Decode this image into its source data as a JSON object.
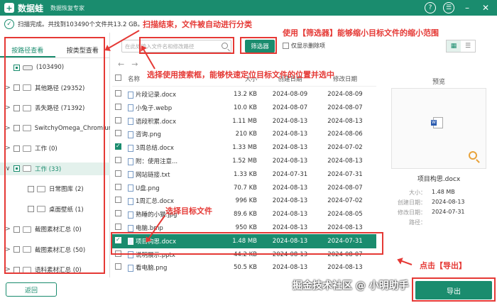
{
  "titlebar": {
    "logo_glyph": "+",
    "app_name": "数据蛙",
    "app_subtitle": "数据恢复专家",
    "controls": [
      "?",
      "☰",
      "–",
      "✕"
    ]
  },
  "status": {
    "text": "扫描完成。共找到103490个文件共13.2 GB。"
  },
  "left": {
    "tabs": [
      "按路径查看",
      "按类型查看"
    ],
    "tree": [
      {
        "label": "(103490)",
        "indent": 0,
        "arrow": "",
        "kind": "drive",
        "check": "part",
        "selected": false
      },
      {
        "label": "其他路径 (29352)",
        "indent": 0,
        "arrow": ">",
        "kind": "folder",
        "check": "none",
        "selected": false
      },
      {
        "label": "丢失路径 (71392)",
        "indent": 0,
        "arrow": ">",
        "kind": "folder",
        "check": "none",
        "selected": false
      },
      {
        "label": "SwitchyOmega_Chromiur",
        "indent": 0,
        "arrow": ">",
        "kind": "folder",
        "check": "none",
        "selected": false
      },
      {
        "label": "工作 (0)",
        "indent": 0,
        "arrow": ">",
        "kind": "folder",
        "check": "none",
        "selected": false
      },
      {
        "label": "工作 (33)",
        "indent": 0,
        "arrow": "∨",
        "kind": "folder",
        "check": "part",
        "selected": true
      },
      {
        "label": "日常图库 (2)",
        "indent": 1,
        "arrow": "",
        "kind": "folder",
        "check": "none",
        "selected": false
      },
      {
        "label": "桌面壁纸 (1)",
        "indent": 1,
        "arrow": "",
        "kind": "folder",
        "check": "none",
        "selected": false
      },
      {
        "label": "截图素材汇总 (0)",
        "indent": 0,
        "arrow": ">",
        "kind": "folder",
        "check": "none",
        "selected": false
      },
      {
        "label": "截图素材汇总 (50)",
        "indent": 0,
        "arrow": ">",
        "kind": "folder",
        "check": "none",
        "selected": false
      },
      {
        "label": "语料素材汇总 (0)",
        "indent": 0,
        "arrow": ">",
        "kind": "folder",
        "check": "none",
        "selected": false
      }
    ],
    "back_label": "返回"
  },
  "toolbar": {
    "search_placeholder": "在此处输入文件名和修改路径",
    "filter_label": "筛选器",
    "only_deleted_label": "仅显示删除项",
    "view_modes": [
      "▦",
      "☰"
    ]
  },
  "nav": {
    "back": "←",
    "forward": "→"
  },
  "table": {
    "headers": {
      "name": "名称",
      "size": "大小",
      "created": "创建日期",
      "modified": "修改日期"
    },
    "rows": [
      {
        "name": "片段记录.docx",
        "size": "13.2 KB",
        "created": "2024-08-09",
        "modified": "2024-08-09",
        "checked": false,
        "selected": false
      },
      {
        "name": "小兔子.webp",
        "size": "10.0 KB",
        "created": "2024-08-07",
        "modified": "2024-08-07",
        "checked": false,
        "selected": false
      },
      {
        "name": "语段积累.docx",
        "size": "1.11 MB",
        "created": "2024-08-13",
        "modified": "2024-08-13",
        "checked": false,
        "selected": false
      },
      {
        "name": "咨询.png",
        "size": "210 KB",
        "created": "2024-08-13",
        "modified": "2024-08-06",
        "checked": false,
        "selected": false
      },
      {
        "name": "3周总结.docx",
        "size": "1.33 MB",
        "created": "2024-08-13",
        "modified": "2024-07-02",
        "checked": true,
        "selected": false
      },
      {
        "name": "附：使用注意...",
        "size": "1.52 MB",
        "created": "2024-08-13",
        "modified": "2024-08-13",
        "checked": false,
        "selected": false
      },
      {
        "name": "网站链接.txt",
        "size": "1.33 KB",
        "created": "2024-07-31",
        "modified": "2024-07-31",
        "checked": false,
        "selected": false
      },
      {
        "name": "U盘.png",
        "size": "70.7 KB",
        "created": "2024-08-13",
        "modified": "2024-08-07",
        "checked": false,
        "selected": false
      },
      {
        "name": "1周汇总.docx",
        "size": "996 KB",
        "created": "2024-08-13",
        "modified": "2024-07-02",
        "checked": false,
        "selected": false
      },
      {
        "name": "熟睡的小猫.jpg",
        "size": "89.6 KB",
        "created": "2024-08-13",
        "modified": "2024-08-05",
        "checked": false,
        "selected": false
      },
      {
        "name": "电脑.bmp",
        "size": "950 KB",
        "created": "2024-08-13",
        "modified": "2024-08-13",
        "checked": false,
        "selected": false
      },
      {
        "name": "项目构思.docx",
        "size": "1.48 MB",
        "created": "2024-08-13",
        "modified": "2024-07-31",
        "checked": true,
        "selected": true
      },
      {
        "name": "说明展示.pptx",
        "size": "44.2 KB",
        "created": "2024-08-13",
        "modified": "2024-08-07",
        "checked": false,
        "selected": false
      },
      {
        "name": "看电脑.png",
        "size": "50.5 KB",
        "created": "2024-08-13",
        "modified": "2024-08-13",
        "checked": false,
        "selected": false
      }
    ]
  },
  "preview": {
    "title": "预览",
    "file_name": "项目构思.docx",
    "size_label": "大小：",
    "size_value": "1.48 MB",
    "created_label": "创建日期：",
    "created_value": "2024-08-13",
    "modified_label": "修改日期：",
    "modified_value": "2024-07-31",
    "path_label": "路径：",
    "path_value": ""
  },
  "export_label": "导出",
  "annotations": {
    "scan_done": "扫描结束，文件被自动进行分类",
    "use_filter": "使用【筛选器】能够缩小目标文件的缩小范围",
    "use_search": "选择使用搜索框，能够快速定位目标文件的位置并选中",
    "select_target": "选择目标文件",
    "click_export": "点击【导出】"
  },
  "watermark": "掘金技术社区 @ 小明助手",
  "colors": {
    "accent": "#1a8c6e",
    "annotation": "#e53935"
  }
}
